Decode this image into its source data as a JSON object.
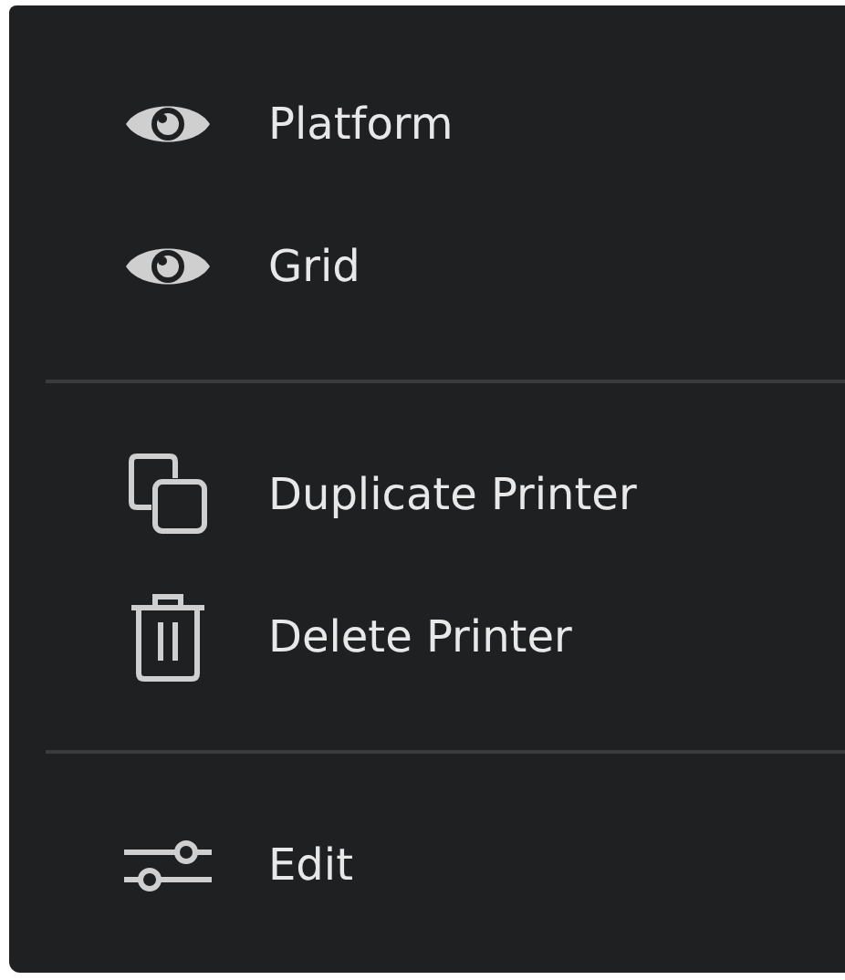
{
  "menu": {
    "sections": [
      {
        "items": [
          {
            "kind": "eye",
            "label": "Platform"
          },
          {
            "kind": "eye",
            "label": "Grid"
          }
        ]
      },
      {
        "items": [
          {
            "kind": "copy",
            "label": "Duplicate Printer"
          },
          {
            "kind": "trash",
            "label": "Delete Printer"
          }
        ]
      },
      {
        "items": [
          {
            "kind": "sliders",
            "label": "Edit"
          }
        ]
      }
    ]
  }
}
